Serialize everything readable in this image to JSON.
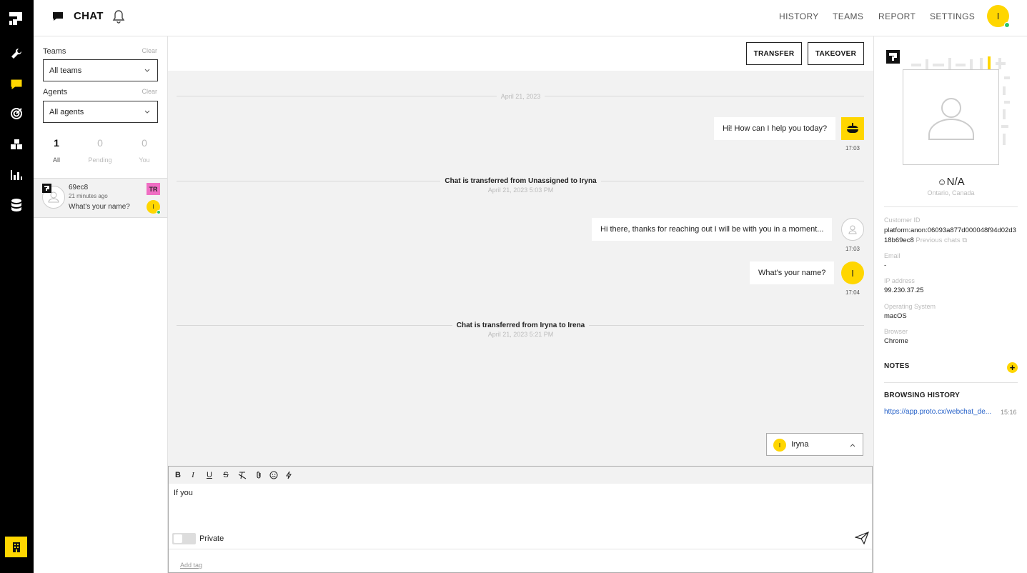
{
  "app": {
    "section_title": "CHAT",
    "nav": [
      "HISTORY",
      "TEAMS",
      "REPORT",
      "SETTINGS"
    ],
    "user_initial": "I",
    "accent_color": "#ffd600"
  },
  "rail": {
    "items": [
      "wrench-icon",
      "chat-icon",
      "target-icon",
      "blocks-icon",
      "bar-chart-icon",
      "database-icon"
    ],
    "active": "chat-icon"
  },
  "filters": {
    "teams_label": "Teams",
    "teams_clear": "Clear",
    "teams_value": "All teams",
    "agents_label": "Agents",
    "agents_clear": "Clear",
    "agents_value": "All agents",
    "counts": [
      {
        "num": "1",
        "label": "All"
      },
      {
        "num": "0",
        "label": "Pending"
      },
      {
        "num": "0",
        "label": "You"
      }
    ]
  },
  "conversations": [
    {
      "id": "69ec8",
      "time": "21 minutes ago",
      "preview": "What's your name?",
      "team_badge": "TR",
      "agent_initial": "I"
    }
  ],
  "chat": {
    "transfer_label": "TRANSFER",
    "takeover_label": "TAKEOVER",
    "date_divider": "April 21, 2023",
    "messages": [
      {
        "text": "Hi! How can I help you today?",
        "time": "17:03"
      },
      {
        "text": "Hi there, thanks for reaching out I will be with you in a moment...",
        "time": "17:03"
      },
      {
        "text": "What's your name?",
        "time": "17:04",
        "initial": "I"
      }
    ],
    "system_events": [
      {
        "title": "Chat is transferred from Unassigned to Iryna",
        "sub": "April 21, 2023 5:03 PM"
      },
      {
        "title": "Chat is transferred from Iryna to Irena",
        "sub": "April 21, 2023 5:21 PM"
      }
    ],
    "agent_select": {
      "initial": "I",
      "name": "Iryna"
    },
    "composer_text": "If you",
    "private_label": "Private",
    "add_tag": "Add tag"
  },
  "profile": {
    "name": "N/A",
    "location": "Ontario, Canada",
    "customer_id_label": "Customer ID",
    "customer_id": "platform:anon:06093a877d000048f94d02d318b69ec8",
    "previous_chats": "Previous chats",
    "email_label": "Email",
    "email": "-",
    "ip_label": "IP address",
    "ip": "99.230.37.25",
    "os_label": "Operating System",
    "os": "macOS",
    "browser_label": "Browser",
    "browser": "Chrome",
    "notes_label": "NOTES",
    "history_label": "BROWSING HISTORY",
    "history": [
      {
        "url": "https://app.proto.cx/webchat_de...",
        "time": "15:16"
      }
    ]
  }
}
